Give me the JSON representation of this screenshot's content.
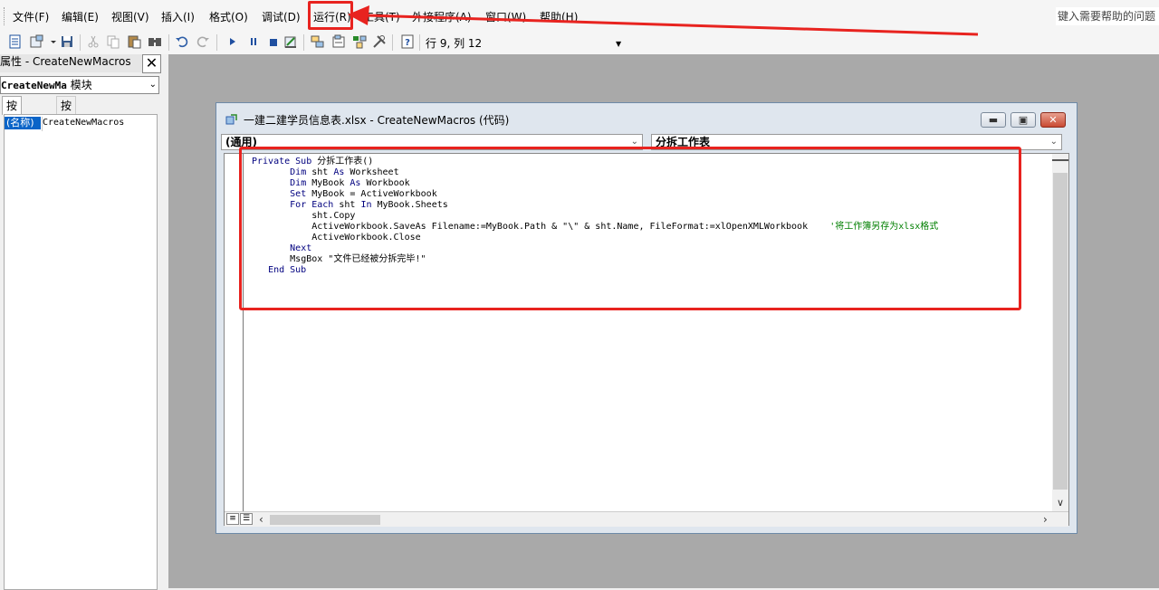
{
  "menu": {
    "items": [
      "文件(F)",
      "编辑(E)",
      "视图(V)",
      "插入(I)",
      "格式(O)",
      "调试(D)",
      "运行(R)",
      "工具(T)",
      "外接程序(A)",
      "窗口(W)",
      "帮助(H)"
    ],
    "help_search": "键入需要帮助的问题"
  },
  "toolbar": {
    "cursor_position": "行 9, 列 12",
    "icons": [
      "view-excel-icon",
      "insert-module-icon",
      "save-icon",
      "cut-icon",
      "copy-icon",
      "paste-icon",
      "find-icon",
      "undo-icon",
      "redo-icon",
      "run-icon",
      "break-icon",
      "reset-icon",
      "design-mode-icon",
      "project-explorer-icon",
      "properties-window-icon",
      "object-browser-icon",
      "toolbox-icon",
      "help-icon"
    ]
  },
  "properties": {
    "title": "属性 - CreateNewMacros",
    "close_label": "✕",
    "object_name": "CreateNewMa",
    "object_type": "模块",
    "tabs": [
      "按字母序",
      "按分类序"
    ],
    "rows": [
      {
        "key": "(名称)",
        "value": "CreateNewMacros"
      }
    ]
  },
  "code_window": {
    "title": "一建二建学员信息表.xlsx - CreateNewMacros (代码)",
    "object_combo": "(通用)",
    "procedure_combo": "分拆工作表",
    "code_lines": [
      {
        "indent": 0,
        "parts": [
          [
            "kw",
            "Private Sub "
          ],
          [
            "tx",
            "分拆工作表()"
          ]
        ]
      },
      {
        "indent": 7,
        "parts": [
          [
            "kw",
            "Dim "
          ],
          [
            "tx",
            "sht "
          ],
          [
            "kw",
            "As "
          ],
          [
            "tx",
            "Worksheet"
          ]
        ]
      },
      {
        "indent": 7,
        "parts": [
          [
            "kw",
            "Dim "
          ],
          [
            "tx",
            "MyBook "
          ],
          [
            "kw",
            "As "
          ],
          [
            "tx",
            "Workbook"
          ]
        ]
      },
      {
        "indent": 7,
        "parts": [
          [
            "kw",
            "Set "
          ],
          [
            "tx",
            "MyBook = ActiveWorkbook"
          ]
        ]
      },
      {
        "indent": 7,
        "parts": [
          [
            "kw",
            "For Each "
          ],
          [
            "tx",
            "sht "
          ],
          [
            "kw",
            "In "
          ],
          [
            "tx",
            "MyBook.Sheets"
          ]
        ]
      },
      {
        "indent": 11,
        "parts": [
          [
            "tx",
            "sht.Copy"
          ]
        ]
      },
      {
        "indent": 11,
        "parts": [
          [
            "tx",
            "ActiveWorkbook.SaveAs Filename:=MyBook.Path & \"\\\" & sht.Name, FileFormat:=xlOpenXMLWorkbook    "
          ],
          [
            "cm",
            "'将工作簿另存为xlsx格式"
          ]
        ]
      },
      {
        "indent": 11,
        "parts": [
          [
            "tx",
            "ActiveWorkbook.Close"
          ]
        ]
      },
      {
        "indent": 7,
        "parts": [
          [
            "kw",
            "Next"
          ]
        ]
      },
      {
        "indent": 7,
        "parts": [
          [
            "tx",
            "MsgBox \"文件已经被分拆完毕!\""
          ]
        ]
      },
      {
        "indent": 3,
        "parts": [
          [
            "kw",
            "End Sub"
          ]
        ]
      }
    ]
  },
  "colors": {
    "annotation_red": "#e8231f",
    "keyword_blue": "#00007f",
    "comment_green": "#007f00",
    "selection_blue": "#0a64c8",
    "mdi_background": "#a9a9a9"
  }
}
